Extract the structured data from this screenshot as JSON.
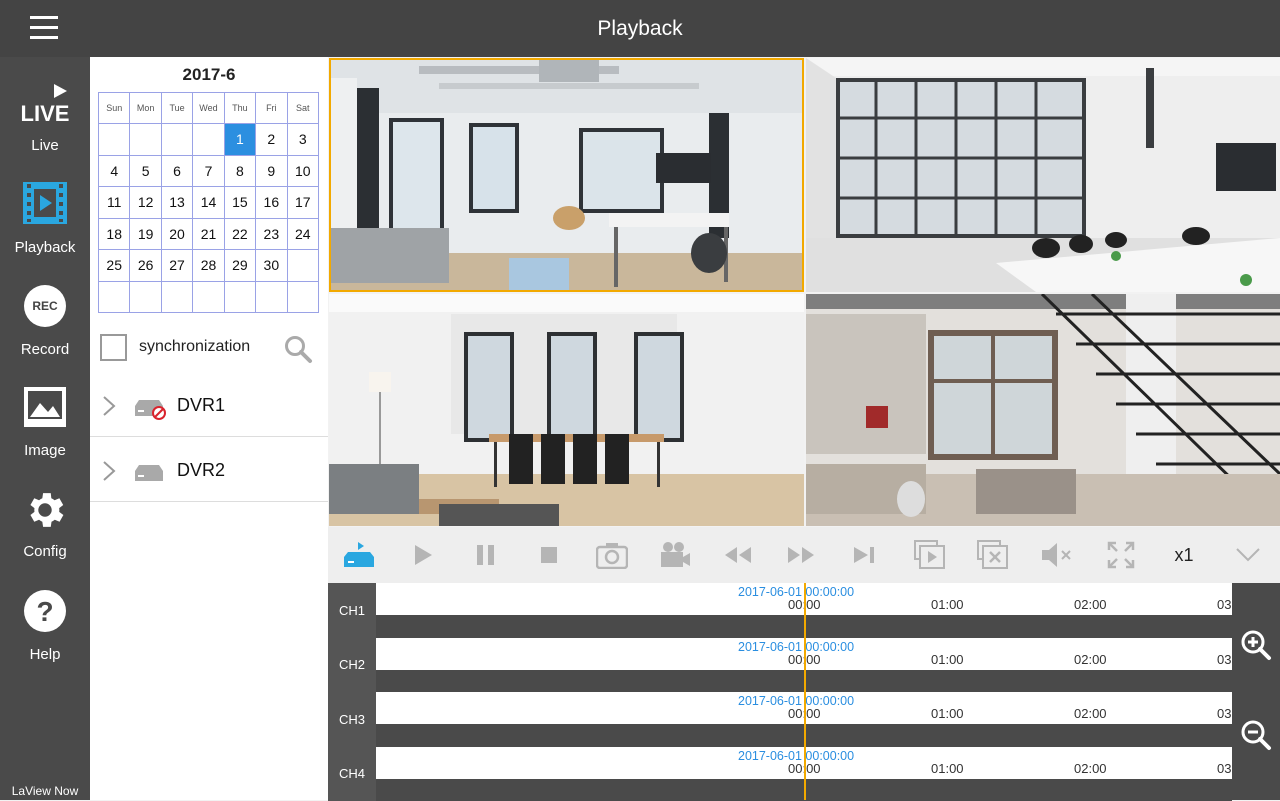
{
  "header": {
    "title": "Playback"
  },
  "sidebar": {
    "items": [
      {
        "label": "Live",
        "icon": "live-icon"
      },
      {
        "label": "Playback",
        "icon": "playback-icon",
        "active": true
      },
      {
        "label": "Record",
        "icon": "rec-icon"
      },
      {
        "label": "Image",
        "icon": "image-icon"
      },
      {
        "label": "Config",
        "icon": "gear-icon"
      },
      {
        "label": "Help",
        "icon": "help-icon"
      }
    ],
    "live_icon_text": "LIVE",
    "rec_icon_text": "REC",
    "brand": "LaView Now"
  },
  "calendar": {
    "title": "2017-6",
    "weekdays": [
      "Sun",
      "Mon",
      "Tue",
      "Wed",
      "Thu",
      "Fri",
      "Sat"
    ],
    "weeks": [
      [
        "",
        "",
        "",
        "",
        "1",
        "2",
        "3"
      ],
      [
        "4",
        "5",
        "6",
        "7",
        "8",
        "9",
        "10"
      ],
      [
        "11",
        "12",
        "13",
        "14",
        "15",
        "16",
        "17"
      ],
      [
        "18",
        "19",
        "20",
        "21",
        "22",
        "23",
        "24"
      ],
      [
        "25",
        "26",
        "27",
        "28",
        "29",
        "30",
        ""
      ],
      [
        "",
        "",
        "",
        "",
        "",
        "",
        ""
      ]
    ],
    "selected_day": "1"
  },
  "sync": {
    "label": "synchronization",
    "checked": false
  },
  "devices": [
    {
      "name": "DVR1",
      "status": "offline"
    },
    {
      "name": "DVR2",
      "status": "online"
    }
  ],
  "toolbar": {
    "buttons": [
      "device-select-icon",
      "play-icon",
      "pause-icon",
      "stop-icon",
      "snapshot-icon",
      "record-clip-icon",
      "rewind-icon",
      "fast-forward-icon",
      "next-frame-icon",
      "playback-window-icon",
      "close-window-icon",
      "mute-icon",
      "fullscreen-icon"
    ],
    "speed": "x1"
  },
  "timeline": {
    "channels": [
      {
        "name": "CH1",
        "date": "2017-06-01 00:00:00"
      },
      {
        "name": "CH2",
        "date": "2017-06-01 00:00:00"
      },
      {
        "name": "CH3",
        "date": "2017-06-01 00:00:00"
      },
      {
        "name": "CH4",
        "date": "2017-06-01 00:00:00"
      }
    ],
    "ticks": [
      "00:00",
      "01:00",
      "02:00",
      "03"
    ]
  },
  "colors": {
    "accent": "#2aa7e0",
    "cursor": "#f2a900",
    "bar": "#4a4a4a"
  }
}
